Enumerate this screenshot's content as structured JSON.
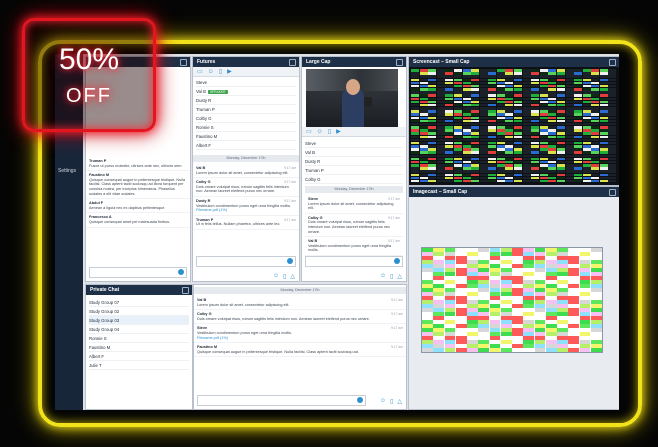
{
  "sidebar": {
    "items": [
      {
        "label": "Settings"
      }
    ]
  },
  "promo": {
    "percent": "50%",
    "label": "OFF"
  },
  "futures": {
    "title": "Futures",
    "members": [
      {
        "name": "Steve",
        "tag": ""
      },
      {
        "name": "Val B",
        "tag": "SPEAKER"
      },
      {
        "name": "Dusty R",
        "tag": ""
      },
      {
        "name": "Truman P",
        "tag": ""
      },
      {
        "name": "Colby G",
        "tag": ""
      },
      {
        "name": "Ronnie S",
        "tag": ""
      },
      {
        "name": "Faustino M",
        "tag": ""
      },
      {
        "name": "Albert F",
        "tag": ""
      }
    ],
    "date": "Monday, December 17th",
    "messages": [
      {
        "who": "Val B",
        "time": "9:17 am",
        "text": "Lorem ipsum dolor sit amet, consectetur adipiscing elit."
      },
      {
        "who": "Colby G",
        "time": "9:17 am",
        "text": "Duis ornare volutpat risus, rutrum sagittis felis interdum non. Aenean laoreet eleifend purus nec ornare."
      },
      {
        "who": "Dusty R",
        "time": "9:17 am",
        "text": "Vestibulum condimentum purus eget urna fringilla mollis.",
        "link": "Filename.pdf (1%)"
      },
      {
        "who": "Truman P",
        "time": "9:17 am",
        "text": "Ut in felis tellus. Nullam pharetra, ultrices ante leo."
      }
    ]
  },
  "left_chat": {
    "messages": [
      {
        "who": "Truman P",
        "time": "",
        "text": "Fusce ut purus molestie, ultrices ante nec, ultrices sem."
      },
      {
        "who": "Faustino M",
        "time": "",
        "text": "Quisque consequat augue in pellentesque tristique. Nulla facilisi. Class aptent taciti sociosqu ad litora torquent per conubia nostra, per inceptos himenaeos. Phasellus sodales a elit vitae sodales."
      },
      {
        "who": "Abdul F",
        "time": "",
        "text": "Aenean a ligula nec ex dapibus pellentesque."
      },
      {
        "who": "Francesco A",
        "time": "",
        "text": "Quisque consequat amet pel malesuada finibus."
      }
    ]
  },
  "largecap": {
    "title": "Large Cap",
    "members": [
      {
        "name": "Steve"
      },
      {
        "name": "Val B"
      },
      {
        "name": "Dusty R"
      },
      {
        "name": "Truman P"
      },
      {
        "name": "Colby G"
      }
    ],
    "date": "Monday, December 17th",
    "messages": [
      {
        "who": "Steve",
        "time": "9:17 am",
        "text": "Lorem ipsum dolor sit amet, consectetur adipiscing elit."
      },
      {
        "who": "Colby G",
        "time": "9:17 am",
        "text": "Duis ornare volutpat risus, rutrum sagittis felis interdum non. Aenean laoreet eleifend purus nec ornare."
      },
      {
        "who": "Val B",
        "time": "9:17 am",
        "text": "Vestibulum condimentum purus eget urna fringilla mollis."
      }
    ]
  },
  "screencast": {
    "title": "Screencast – Small Cap"
  },
  "imagecast": {
    "title": "Imagecast – Small Cap"
  },
  "private_chat": {
    "title": "Private Chat",
    "groups": [
      {
        "name": "Study Group 07"
      },
      {
        "name": "Study Group 02"
      },
      {
        "name": "Study Group 03"
      },
      {
        "name": "Study Group 04"
      },
      {
        "name": "Ronnie S"
      },
      {
        "name": "Faustino M"
      },
      {
        "name": "Albert F"
      },
      {
        "name": "Julie T"
      }
    ],
    "date": "Monday, December 17th",
    "messages": [
      {
        "who": "Val B",
        "time": "9:17 am",
        "text": "Lorem ipsum dolor sit amet, consectetur adipiscing elit."
      },
      {
        "who": "Colby G",
        "time": "9:17 am",
        "text": "Duis ornare volutpat risus, rutrum sagittis felis interdum non. Aenean laoreet eleifend purus nec ornare."
      },
      {
        "who": "Steve",
        "time": "9:17 am",
        "text": "Vestibulum condimentum purus eget urna fringilla mollis.",
        "link": "Filename.pdf (1%)"
      },
      {
        "who": "Faustino M",
        "time": "9:17 am",
        "text": "Quisque consequat augue in pellentesque tristique. Nulla facilisi. Class aptent taciti sociosqu ad."
      }
    ]
  },
  "colors": {
    "accent": "#2d8fd0",
    "header": "#1e3048",
    "neon_yellow": "#f2e21a",
    "neon_red": "#e3161f"
  }
}
